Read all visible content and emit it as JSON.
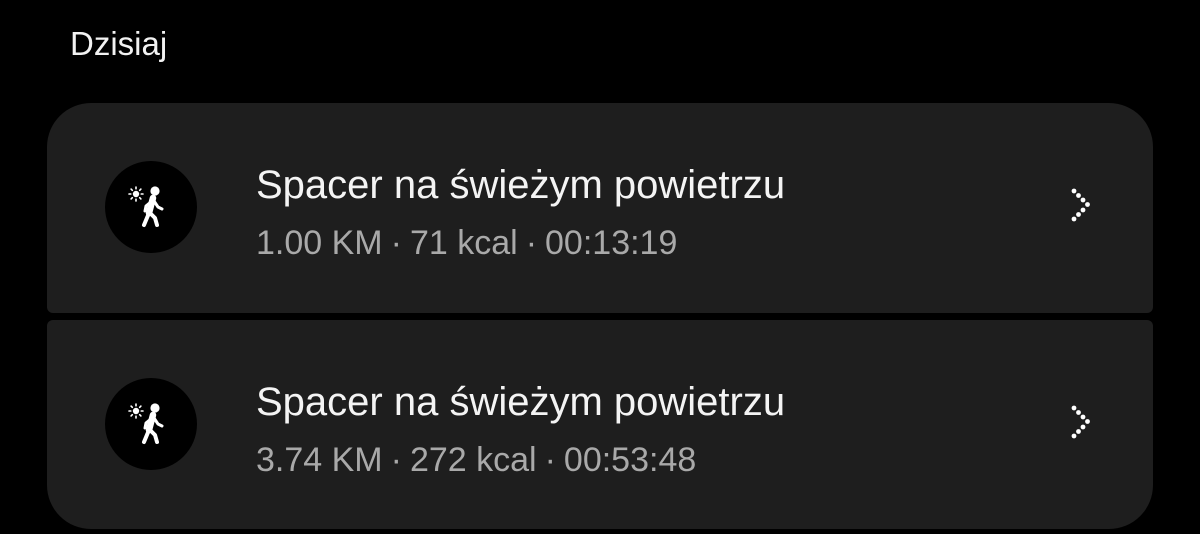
{
  "section": {
    "title": "Dzisiaj"
  },
  "activities": [
    {
      "title": "Spacer na świeżym powietrzu",
      "distance": "1.00 KM",
      "calories": "71 kcal",
      "duration": "00:13:19",
      "separator": "·",
      "icon": "outdoor-walk-icon"
    },
    {
      "title": "Spacer na świeżym powietrzu",
      "distance": "3.74 KM",
      "calories": "272 kcal",
      "duration": "00:53:48",
      "separator": "·",
      "icon": "outdoor-walk-icon"
    }
  ],
  "colors": {
    "background": "#000000",
    "card": "#1e1e1e",
    "title_text": "#f4f4f4",
    "stats_text": "#a9a9a9"
  }
}
